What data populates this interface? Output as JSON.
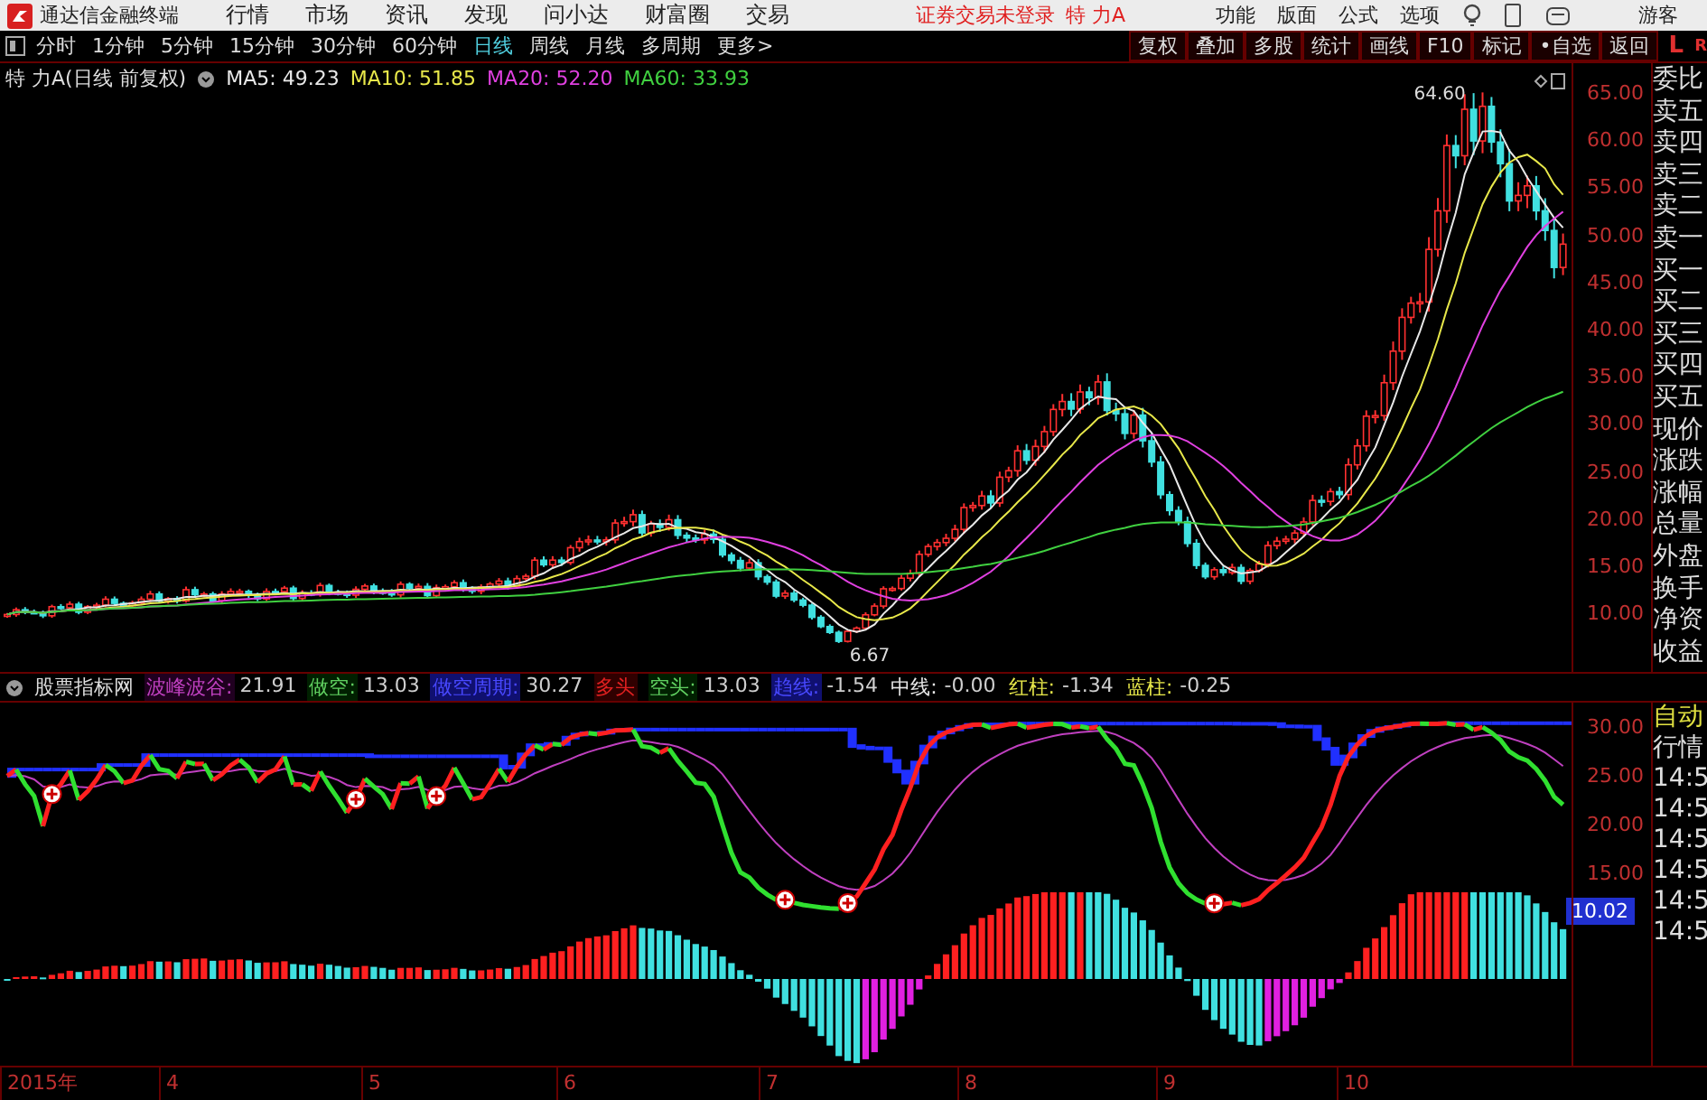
{
  "title_bar": {
    "app_name": "通达信金融终端",
    "menus": [
      "行情",
      "市场",
      "资讯",
      "发现",
      "问小达",
      "财富圈",
      "交易"
    ],
    "login_notice": "证券交易未登录",
    "stock": "特 力A",
    "tools": [
      "功能",
      "版面",
      "公式",
      "选项"
    ],
    "user": "游客"
  },
  "period_tabs": [
    {
      "label": "分时",
      "selected": false
    },
    {
      "label": "1分钟",
      "selected": false
    },
    {
      "label": "5分钟",
      "selected": false
    },
    {
      "label": "15分钟",
      "selected": false
    },
    {
      "label": "30分钟",
      "selected": false
    },
    {
      "label": "60分钟",
      "selected": false
    },
    {
      "label": "日线",
      "selected": true
    },
    {
      "label": "周线",
      "selected": false
    },
    {
      "label": "月线",
      "selected": false
    },
    {
      "label": "多周期",
      "selected": false
    },
    {
      "label": "更多>",
      "selected": false
    }
  ],
  "chart_tools": [
    "复权",
    "叠加",
    "多股",
    "统计",
    "画线",
    "F10",
    "标记",
    "•自选",
    "返回"
  ],
  "corner_labels": [
    "L",
    "R"
  ],
  "main_chart": {
    "stock_label": "特 力A",
    "mode": "(日线 前复权)",
    "ma": [
      {
        "name": "MA5:",
        "value": "49.23",
        "color": "#e8e8e8"
      },
      {
        "name": "MA10:",
        "value": "51.85",
        "color": "#e8e84a"
      },
      {
        "name": "MA20:",
        "value": "52.20",
        "color": "#e040e0"
      },
      {
        "name": "MA60:",
        "value": "33.93",
        "color": "#40d040"
      }
    ],
    "high_label": "64.60",
    "low_label": "6.67",
    "price_ticks": [
      "65.00",
      "60.00",
      "55.00",
      "50.00",
      "45.00",
      "40.00",
      "35.00",
      "30.00",
      "25.00",
      "20.00",
      "15.00",
      "10.00"
    ]
  },
  "quote_fields": [
    "委比",
    "卖五",
    "卖四",
    "卖三",
    "卖二",
    "卖一",
    "买一",
    "买二",
    "买三",
    "买四",
    "买五",
    "现价",
    "涨跌",
    "涨幅",
    "总量",
    "外盘",
    "换手",
    "净资",
    "收益"
  ],
  "indicator": {
    "name": "股票指标网",
    "items": [
      {
        "label": "波峰波谷:",
        "value": "21.91",
        "kind": "peak"
      },
      {
        "label": "做空:",
        "value": "13.03",
        "kind": "short"
      },
      {
        "label": "做空周期:",
        "value": "30.27",
        "kind": "cycle"
      },
      {
        "label": "多头",
        "kind": "long"
      },
      {
        "label": "空头:",
        "value": "13.03",
        "kind": "short"
      },
      {
        "label": "趋线:",
        "value": "-1.54",
        "kind": "cycle"
      },
      {
        "label": "中线:",
        "value": "-0.00",
        "kind": "mid"
      },
      {
        "label": "红柱:",
        "value": "-1.34",
        "kind": "bar"
      },
      {
        "label": "蓝柱:",
        "value": "-0.25",
        "kind": "bar"
      }
    ],
    "ticks": [
      "30.00",
      "25.00",
      "20.00",
      "15.00"
    ],
    "current": "10.02"
  },
  "lower_side": {
    "mode": [
      "自动",
      "行情"
    ],
    "times": [
      "14:5",
      "14:5",
      "14:5",
      "14:5",
      "14:5",
      "14:5"
    ]
  },
  "date_axis": [
    "2015年",
    "4",
    "5",
    "6",
    "7",
    "8",
    "9",
    "10"
  ]
}
